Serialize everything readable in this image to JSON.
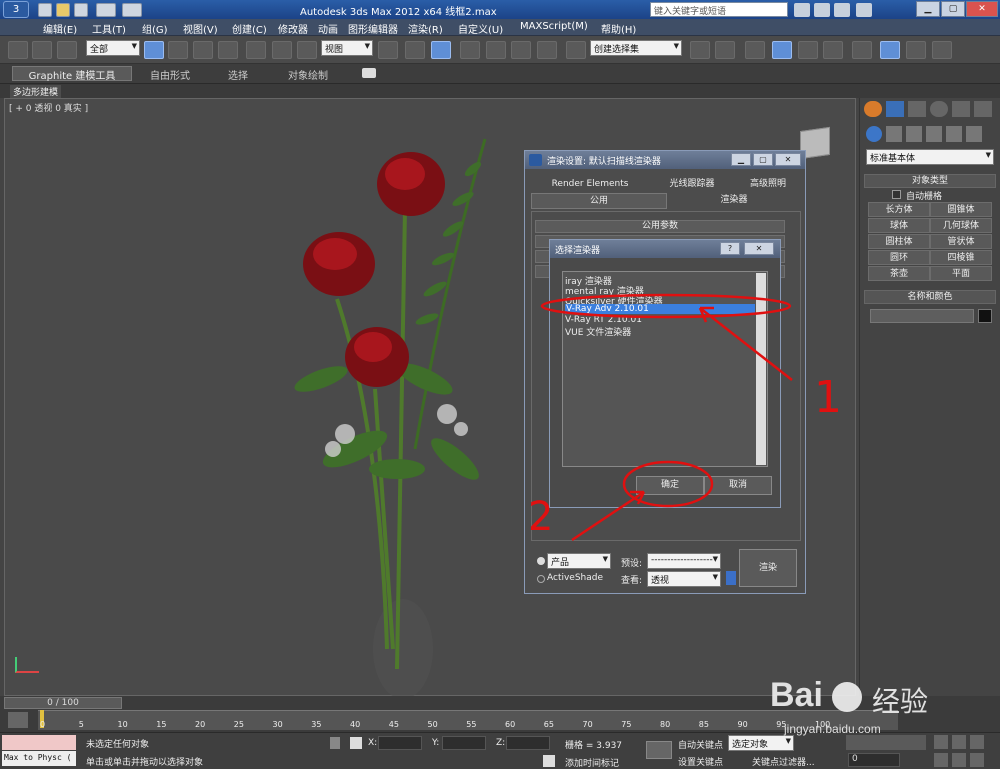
{
  "window": {
    "title": "Autodesk 3ds Max  2012 x64     线框2.max",
    "search_placeholder": "键入关键字或短语"
  },
  "menu": [
    "编辑(E)",
    "工具(T)",
    "组(G)",
    "视图(V)",
    "创建(C)",
    "修改器",
    "动画",
    "图形编辑器",
    "渲染(R)",
    "自定义(U)",
    "MAXScript(M)",
    "帮助(H)"
  ],
  "toolbar": {
    "selection_filter": "全部",
    "ref_coord": "视图",
    "named_set": "创建选择集"
  },
  "ribbon": {
    "tabs": [
      "Graphite 建模工具",
      "自由形式",
      "选择",
      "对象绘制"
    ],
    "panel": "多边形建模"
  },
  "viewport": {
    "label": "[ + 0 透视 0 真实 ]"
  },
  "cmd_panel": {
    "category": "标准基本体",
    "object_type_header": "对象类型",
    "autogrid": "自动栅格",
    "objects": [
      "长方体",
      "圆锥体",
      "球体",
      "几何球体",
      "圆柱体",
      "管状体",
      "圆环",
      "四棱锥",
      "茶壶",
      "平面"
    ],
    "name_color_header": "名称和颜色"
  },
  "render_dialog": {
    "title": "渲染设置: 默认扫描线渲染器",
    "tabs_row1": [
      "Render Elements",
      "光线跟踪器",
      "高级照明"
    ],
    "tabs_row2": [
      "公用",
      "渲染器"
    ],
    "rollout": "公用参数",
    "mode_product": "产品",
    "mode_activeshade": "ActiveShade",
    "preset_label": "预设:",
    "preset_value": "-------------------",
    "view_label": "查看:",
    "view_value": "透视",
    "render_button": "渲染"
  },
  "choose_renderer": {
    "title": "选择渲染器",
    "items": [
      "iray 渲染器",
      "mental ray 渲染器",
      "Quicksilver 硬件渲染器",
      "V-Ray Adv 2.10.01",
      "V-Ray RT 2.10.01",
      "VUE 文件渲染器"
    ],
    "selected_index": 3,
    "ok": "确定",
    "cancel": "取消"
  },
  "annotations": {
    "num1": "1",
    "num2": "2"
  },
  "timeline": {
    "frame": "0 / 100",
    "ticks": [
      "0",
      "5",
      "10",
      "15",
      "20",
      "25",
      "30",
      "35",
      "40",
      "45",
      "50",
      "55",
      "60",
      "65",
      "70",
      "75",
      "80",
      "85",
      "90",
      "95",
      "100"
    ]
  },
  "status": {
    "script_field": "Max to Physc (",
    "line1": "未选定任何对象",
    "line2": "单击或单击并拖动以选择对象",
    "x": "X:",
    "y": "Y:",
    "z": "Z:",
    "grid": "栅格 = 3.937",
    "add_time_tag": "添加时间标记",
    "auto_key": "自动关键点",
    "set_key": "设置关键点",
    "selected": "选定对象",
    "key_filters": "关键点过滤器...",
    "frame_value": "0"
  },
  "watermark": {
    "brand": "Bai",
    "paw": "度",
    "jingyan": "经验",
    "url": "jingyan.baidu.com"
  }
}
